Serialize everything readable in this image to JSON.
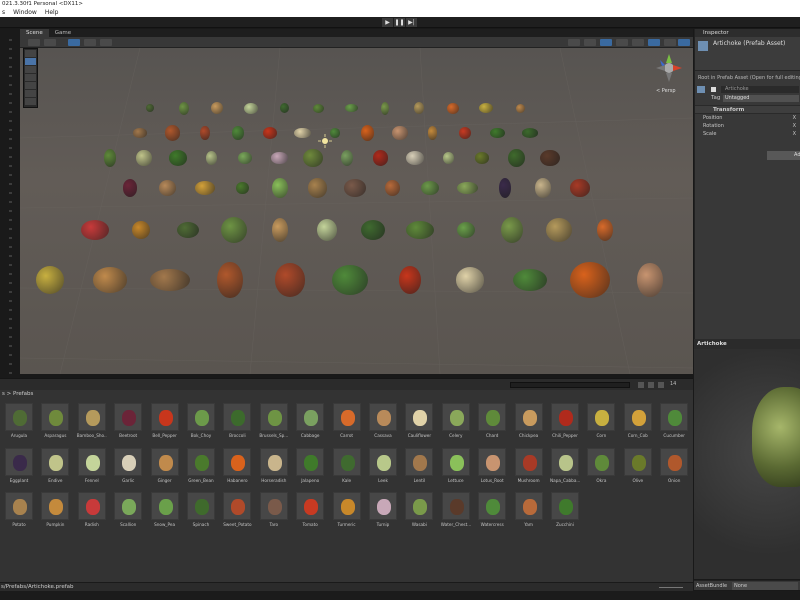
{
  "window": {
    "title": "021.3.30f1 Personal <DX11>"
  },
  "menu": [
    "s",
    "Window",
    "Help"
  ],
  "toolbar": {
    "play": "▶",
    "pause": "❚❚",
    "step": "▶|"
  },
  "scene_tabs": [
    {
      "label": "Scene",
      "active": true
    },
    {
      "label": "Game",
      "active": false
    }
  ],
  "persp_label": "< Persp",
  "inspector": {
    "tab": "Inspector",
    "asset_title": "Artichoke (Prefab Asset)",
    "root_note": "Root in Prefab Asset (Open for full editing su",
    "name_value": "Artichoke",
    "tag_label": "Tag",
    "tag_value": "Untagged",
    "component": "Transform",
    "props": [
      {
        "label": "Position",
        "axis": "X"
      },
      {
        "label": "Rotation",
        "axis": "X"
      },
      {
        "label": "Scale",
        "axis": "X"
      }
    ],
    "add_label": "Ad"
  },
  "preview": {
    "title": "Artichoke"
  },
  "assetbundle": {
    "label": "AssetBundle",
    "value": "None"
  },
  "project": {
    "breadcrumb": "s > Prefabs",
    "badge": "14",
    "footer_path": "s/Prefabs/Artichoke.prefab",
    "items": [
      "Arugula",
      "Asparagus",
      "Bamboo_Sho...",
      "Beetroot",
      "Bell_Pepper",
      "Bok_Choy",
      "Broccoli",
      "Brussels_Sp...",
      "Cabbage",
      "Carrot",
      "Cassava",
      "Cauliflower",
      "Celery",
      "Chard",
      "Chickpea",
      "Chili_Pepper",
      "Corn",
      "Corn_Cob",
      "Cucumber",
      "Eggplant",
      "Endive",
      "Fennel",
      "Garlic",
      "Ginger",
      "Green_Bean",
      "Habanero",
      "Horseradish",
      "Jalapeno",
      "Kale",
      "Leek",
      "Lentil",
      "Lettuce",
      "Lotus_Root",
      "Mushroom",
      "Napa_Cabba...",
      "Okra",
      "Olive",
      "Onion",
      "Potato",
      "Pumpkin",
      "Radish",
      "Scallion",
      "Snow_Pea",
      "Spinach",
      "Sweet_Potato",
      "Taro",
      "Tomato",
      "Turmeric",
      "Turnip",
      "Wasabi",
      "Water_Chest...",
      "Watercress",
      "Yam",
      "Zucchini"
    ],
    "colors": [
      "#4f6b35",
      "#6f8a3c",
      "#b59a5c",
      "#6b2438",
      "#c8361c",
      "#6c9a4a",
      "#3c6a2c",
      "#6e9444",
      "#7aa060",
      "#d76a2a",
      "#b88a5a",
      "#e0d2a8",
      "#8aa85a",
      "#5f8a3a",
      "#c99b5e",
      "#b02a1c",
      "#c8b040",
      "#d3a13a",
      "#4f8a3a",
      "#3a2a4a",
      "#c0c48a",
      "#c4d49a",
      "#d8cfb8",
      "#c08a4c",
      "#4a7a2c",
      "#d9621c",
      "#c9b58c",
      "#3f7a2a",
      "#3f6a2f",
      "#b8c88a",
      "#a2784c",
      "#8ac05a",
      "#c89470",
      "#a83a26",
      "#b8c48a",
      "#5f8a3a",
      "#6a7a2a",
      "#b0582c",
      "#a8824e",
      "#c48a3c",
      "#c83a3a",
      "#7aa85a",
      "#6aa04a",
      "#3f6a2c",
      "#b04a2a",
      "#7a5a4a",
      "#c83a22",
      "#c8882a",
      "#c8a8b8",
      "#7a9a4a",
      "#5a3a2a",
      "#4f8a3a",
      "#b86a3a",
      "#3f7a2c"
    ]
  }
}
